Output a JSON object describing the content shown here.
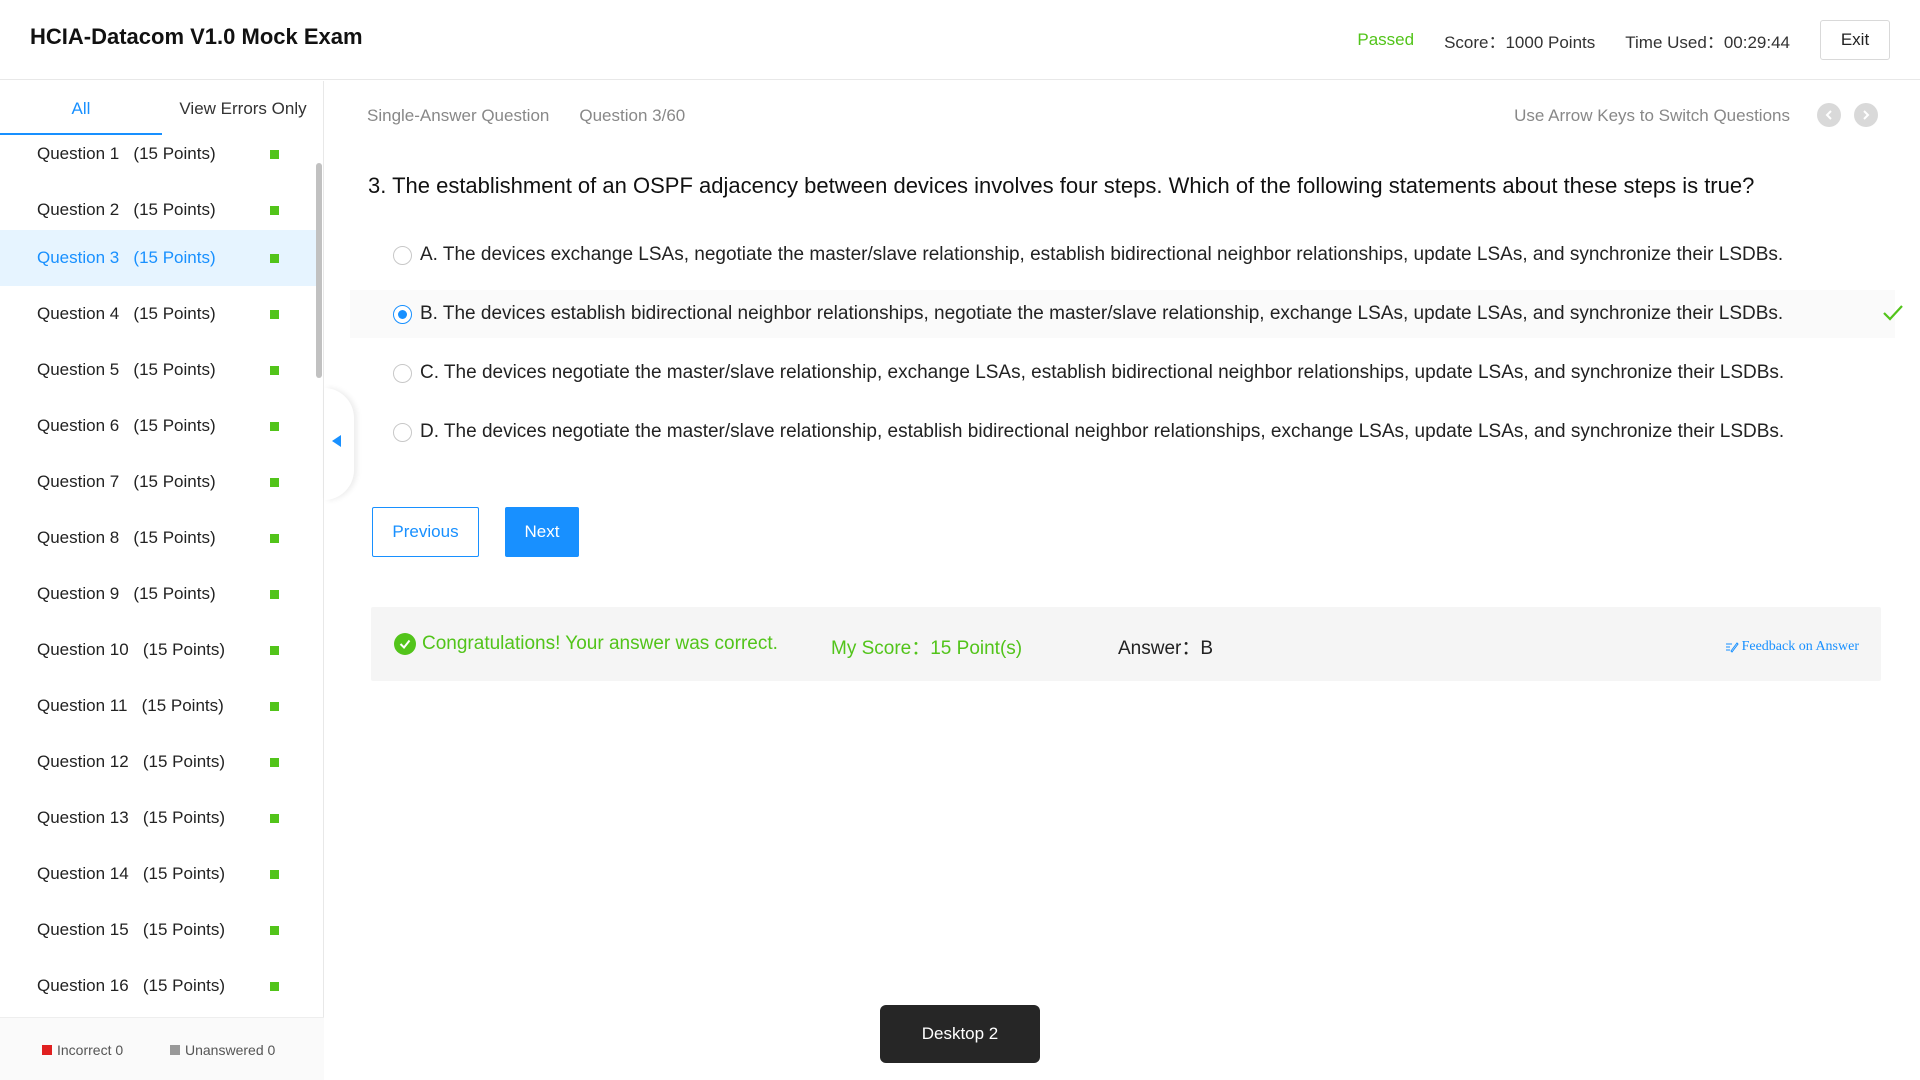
{
  "header": {
    "title": "HCIA-Datacom V1.0 Mock Exam",
    "status": "Passed",
    "score": "Score：1000 Points",
    "time_used": "Time Used：00:29:44",
    "exit_label": "Exit",
    "colors": {
      "passed": "#52c41a"
    }
  },
  "sidebar": {
    "tabs": [
      "All",
      "View Errors Only"
    ],
    "active_tab": "All",
    "questions": [
      {
        "num": "Question 1",
        "points": "(15 Points)"
      },
      {
        "num": "Question 2",
        "points": "(15 Points)"
      },
      {
        "num": "Question 3",
        "points": "(15 Points)"
      },
      {
        "num": "Question 4",
        "points": "(15 Points)"
      },
      {
        "num": "Question 5",
        "points": "(15 Points)"
      },
      {
        "num": "Question 6",
        "points": "(15 Points)"
      },
      {
        "num": "Question 7",
        "points": "(15 Points)"
      },
      {
        "num": "Question 8",
        "points": "(15 Points)"
      },
      {
        "num": "Question 9",
        "points": "(15 Points)"
      },
      {
        "num": "Question 10",
        "points": "(15 Points)"
      },
      {
        "num": "Question 11",
        "points": "(15 Points)"
      },
      {
        "num": "Question 12",
        "points": "(15 Points)"
      },
      {
        "num": "Question 13",
        "points": "(15 Points)"
      },
      {
        "num": "Question 14",
        "points": "(15 Points)"
      },
      {
        "num": "Question 15",
        "points": "(15 Points)"
      },
      {
        "num": "Question 16",
        "points": "(15 Points)"
      }
    ],
    "active_question": "Question 3",
    "legend": {
      "incorrect": "Incorrect 0",
      "unanswered": "Unanswered 0"
    },
    "colors": {
      "correct": "#52c41a",
      "incorrect": "#e02020",
      "unanswered": "#999999"
    }
  },
  "main": {
    "question_type": "Single-Answer Question",
    "question_index": "Question 3/60",
    "nav_hint": "Use Arrow Keys to Switch Questions",
    "question_text": "3. The establishment of an OSPF adjacency between devices involves four steps. Which of the following statements about these steps is true?",
    "options": [
      {
        "text": "A. The devices exchange LSAs, negotiate the master/slave relationship, establish bidirectional neighbor relationships, update LSAs, and synchronize their LSDBs."
      },
      {
        "text": "B. The devices establish bidirectional neighbor relationships, negotiate the master/slave relationship, exchange LSAs, update LSAs, and synchronize their LSDBs."
      },
      {
        "text": "C. The devices negotiate the master/slave relationship, exchange LSAs, establish bidirectional neighbor relationships, update LSAs, and synchronize their LSDBs."
      },
      {
        "text": "D. The devices negotiate the master/slave relationship, establish bidirectional neighbor relationships, exchange LSAs, update LSAs, and synchronize their LSDBs."
      }
    ],
    "selected_option": "B",
    "previous_label": "Previous",
    "next_label": "Next",
    "result": {
      "message": "Congratulations! Your answer was correct.",
      "my_score": "My Score：15 Point(s)",
      "answer": "Answer：B",
      "feedback": "Feedback on Answer"
    },
    "colors": {
      "accent": "#1890ff",
      "correct": "#52c41a"
    }
  },
  "taskbar": {
    "popup": "Desktop 2"
  }
}
